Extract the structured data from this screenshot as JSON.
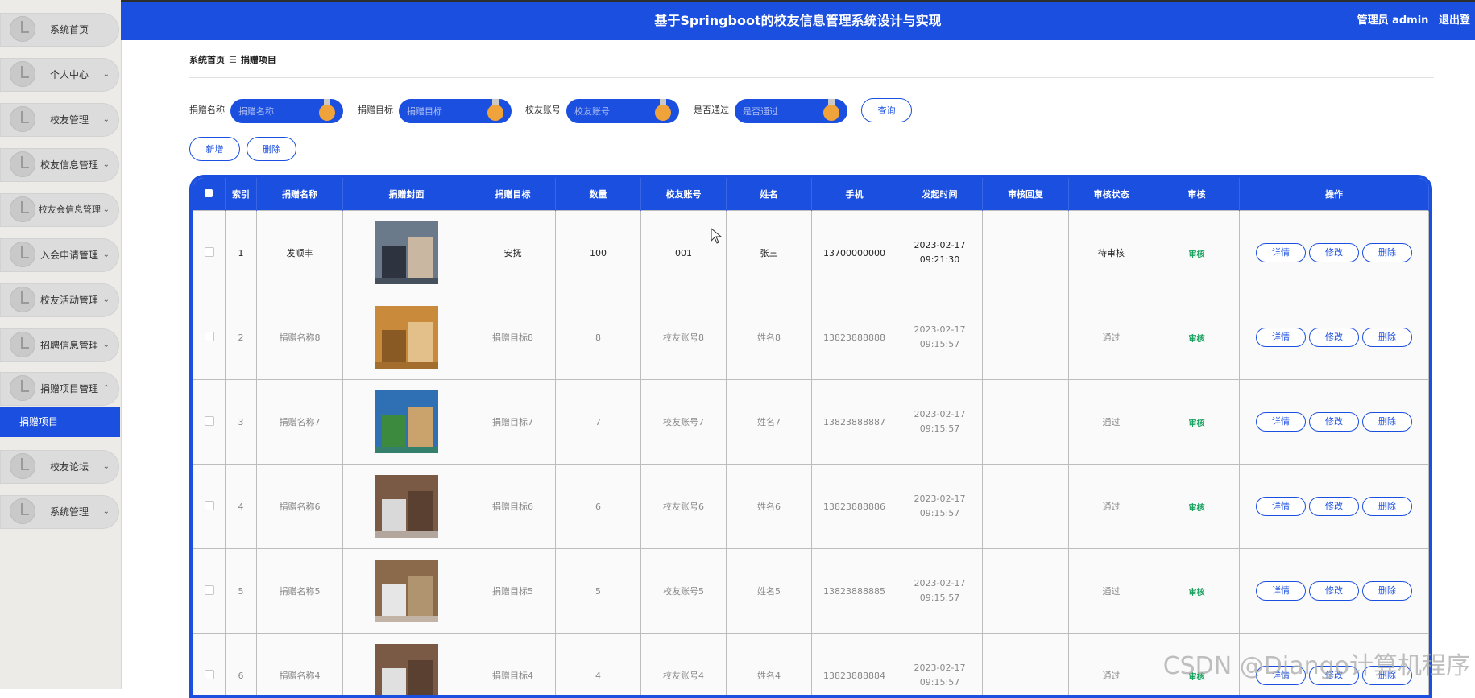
{
  "header": {
    "title": "基于Springboot的校友信息管理系统设计与实现",
    "user": "管理员 admin",
    "logout": "退出登"
  },
  "sidebar": {
    "items": [
      {
        "label": "系统首页",
        "chevron": ""
      },
      {
        "label": "个人中心",
        "chevron": "⌄"
      },
      {
        "label": "校友管理",
        "chevron": "⌄"
      },
      {
        "label": "校友信息管理",
        "chevron": "⌄"
      },
      {
        "label": "校友会信息管理",
        "chevron": "⌄"
      },
      {
        "label": "入会申请管理",
        "chevron": "⌄"
      },
      {
        "label": "校友活动管理",
        "chevron": "⌄"
      },
      {
        "label": "招聘信息管理",
        "chevron": "⌄"
      },
      {
        "label": "捐赠项目管理",
        "chevron": "⌃"
      },
      {
        "label": "校友论坛",
        "chevron": "⌄"
      },
      {
        "label": "系统管理",
        "chevron": "⌄"
      }
    ],
    "active_sub": "捐赠项目"
  },
  "breadcrumb": {
    "home": "系统首页",
    "sep": "☰",
    "current": "捐赠项目"
  },
  "search": {
    "fields": [
      {
        "label": "捐赠名称",
        "placeholder": "捐赠名称"
      },
      {
        "label": "捐赠目标",
        "placeholder": "捐赠目标"
      },
      {
        "label": "校友账号",
        "placeholder": "校友账号"
      },
      {
        "label": "是否通过",
        "placeholder": "是否通过"
      }
    ],
    "query_label": "查询"
  },
  "actions": {
    "add_label": "新增",
    "delete_label": "删除"
  },
  "table": {
    "headers": [
      "索引",
      "捐赠名称",
      "捐赠封面",
      "捐赠目标",
      "数量",
      "校友账号",
      "姓名",
      "手机",
      "发起时间",
      "审核回复",
      "审核状态",
      "审核",
      "操作"
    ],
    "rows": [
      {
        "index": "1",
        "name": "发顺丰",
        "target": "安抚",
        "qty": "100",
        "account": "001",
        "person": "张三",
        "phone": "13700000000",
        "time": "2023-02-17 09:21:30",
        "reply": "",
        "status": "待审核",
        "audit": "审核"
      },
      {
        "index": "2",
        "name": "捐赠名称8",
        "target": "捐赠目标8",
        "qty": "8",
        "account": "校友账号8",
        "person": "姓名8",
        "phone": "13823888888",
        "time": "2023-02-17 09:15:57",
        "reply": "",
        "status": "通过",
        "audit": "审核"
      },
      {
        "index": "3",
        "name": "捐赠名称7",
        "target": "捐赠目标7",
        "qty": "7",
        "account": "校友账号7",
        "person": "姓名7",
        "phone": "13823888887",
        "time": "2023-02-17 09:15:57",
        "reply": "",
        "status": "通过",
        "audit": "审核"
      },
      {
        "index": "4",
        "name": "捐赠名称6",
        "target": "捐赠目标6",
        "qty": "6",
        "account": "校友账号6",
        "person": "姓名6",
        "phone": "13823888886",
        "time": "2023-02-17 09:15:57",
        "reply": "",
        "status": "通过",
        "audit": "审核"
      },
      {
        "index": "5",
        "name": "捐赠名称5",
        "target": "捐赠目标5",
        "qty": "5",
        "account": "校友账号5",
        "person": "姓名5",
        "phone": "13823888885",
        "time": "2023-02-17 09:15:57",
        "reply": "",
        "status": "通过",
        "audit": "审核"
      },
      {
        "index": "6",
        "name": "捐赠名称4",
        "target": "捐赠目标4",
        "qty": "4",
        "account": "校友账号4",
        "person": "姓名4",
        "phone": "13823888884",
        "time": "2023-02-17 09:15:57",
        "reply": "",
        "status": "通过",
        "audit": "审核"
      }
    ],
    "row_buttons": {
      "detail": "详情",
      "edit": "修改",
      "delete": "删除"
    }
  },
  "watermark": "CSDN @Django计算机程序",
  "colors": {
    "primary": "#1a4fe0",
    "audit_green": "#1aa260",
    "medal": "#f0a33a"
  }
}
